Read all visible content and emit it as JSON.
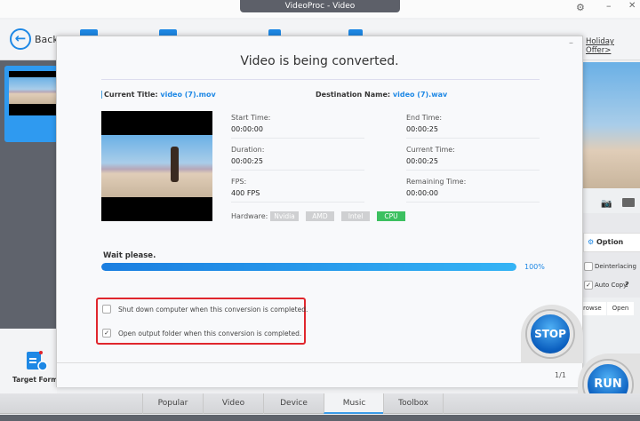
{
  "window": {
    "title": "VideoProc - Video"
  },
  "toolbar": {
    "back_label": "Back",
    "holiday_offer": "Holiday Offer>"
  },
  "dialog": {
    "title": "Video is being converted.",
    "current_title_label": "Current Title:",
    "current_title": "video (7).mov",
    "destination_label": "Destination Name:",
    "destination": "video (7).wav",
    "fields": {
      "start_time_label": "Start Time:",
      "start_time": "00:00:00",
      "end_time_label": "End Time:",
      "end_time": "00:00:25",
      "duration_label": "Duration:",
      "duration": "00:00:25",
      "current_time_label": "Current Time:",
      "current_time": "00:00:25",
      "fps_label": "FPS:",
      "fps": "400 FPS",
      "remaining_label": "Remaining Time:",
      "remaining": "00:00:00"
    },
    "hardware_label": "Hardware:",
    "hardware": [
      "Nvidia",
      "AMD",
      "Intel",
      "CPU"
    ],
    "hardware_active": "CPU",
    "status": "Wait please.",
    "progress_percent": 100,
    "progress_text": "100%",
    "options": [
      {
        "label": "Shut down computer when this conversion is completed.",
        "checked": false
      },
      {
        "label": "Open output folder when this conversion is completed.",
        "checked": true
      }
    ],
    "stop_label": "STOP",
    "page": "1/1"
  },
  "right_panel": {
    "option_label": "Option",
    "deinterlacing": "Deinterlacing",
    "auto_copy": "Auto Copy",
    "help": "?",
    "browse": "rowse",
    "open": "Open"
  },
  "left_bottom": {
    "target_format": "Target Format"
  },
  "run_label": "RUN",
  "tabs": [
    "Popular",
    "Video",
    "Device",
    "Music",
    "Toolbox"
  ],
  "active_tab": "Music",
  "colors": {
    "accent": "#1e88e5",
    "cpu_active": "#3cc060",
    "highlight": "#e0262d"
  }
}
